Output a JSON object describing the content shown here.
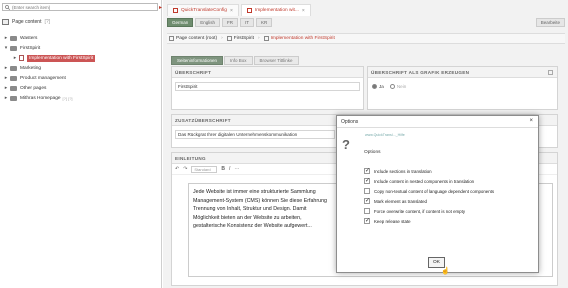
{
  "search": {
    "placeholder": "(Enter search item)"
  },
  "tree": {
    "root_label": "Page content",
    "root_extra": "[?]",
    "items": [
      {
        "label": "Wasters",
        "toggle": "▸",
        "type": "folder"
      },
      {
        "label": "FirstSpirit",
        "toggle": "▾",
        "type": "folder"
      },
      {
        "label": "Implementation with FirstSpirit",
        "toggle": "▸",
        "type": "page",
        "child": true,
        "selected": true
      },
      {
        "label": "Marketing",
        "toggle": "▸",
        "type": "folder"
      },
      {
        "label": "Product management",
        "toggle": "▸",
        "type": "folder"
      },
      {
        "label": "Other pages",
        "toggle": "▸",
        "type": "folder"
      },
      {
        "label": "Mithras Homepage",
        "toggle": "▸",
        "type": "folder",
        "extra": "[?] [?]"
      }
    ]
  },
  "tabs": [
    {
      "label": "QuickTranslateConfig",
      "close": "×"
    },
    {
      "label": "Implementation wit...",
      "close": "×"
    }
  ],
  "toolbar": {
    "languages": [
      "German",
      "English",
      "FR",
      "IT",
      "KR"
    ],
    "active_language": "German",
    "right_label": "Bearbeite"
  },
  "breadcrumb": {
    "items": [
      "Page content (root)",
      "FirstSpirit",
      "Implementation with FirstSpirit"
    ],
    "separator": "›"
  },
  "form_tabs": [
    "Seiteninformationen",
    "Info Box",
    "Browser Tittlinke"
  ],
  "fields": {
    "headline": {
      "label": "ÜBERSCHRIFT",
      "value": "FirstSpirit"
    },
    "headline_graphic": {
      "label": "ÜBERSCHRIFT ALS GRAFIK ERZEUGEN",
      "yes": "Ja",
      "no": "Nein"
    },
    "subheadline": {
      "label": "ZUSATZÜBERSCHRIFT",
      "value": "Das Rückgrat Ihrer digitalen Unternehmenskommunikation"
    },
    "intro": {
      "label": "EINLEITUNG",
      "toolbar": {
        "undo": "↶",
        "redo": "↷",
        "format": "Standard",
        "bold": "B",
        "italic": "I",
        "more": "···"
      },
      "lines": [
        "Jede Website ist immer eine strukturierte Sammlung",
        "Management-System (CMS) können Sie diese Erfahrung",
        "Trennung von Inhalt, Struktur und Design. Damit",
        "Möglichkeit bieten an der Website zu arbeiten,",
        "gestalterische Konsistenz der Website aufgewert..."
      ]
    }
  },
  "dialog": {
    "title": "Options",
    "close": "×",
    "help_icon": "?",
    "help_link": "www.QuickTransl..._Hilfe",
    "options_title": "Options",
    "options": [
      {
        "label": "Include sections in translation",
        "checked": true
      },
      {
        "label": "Include content in nested components in translation",
        "checked": true
      },
      {
        "label": "Copy non-textual content of language dependent components",
        "checked": false
      },
      {
        "label": "Mark element as translated",
        "checked": true
      },
      {
        "label": "Force overwrite content, if content is not empty",
        "checked": false
      },
      {
        "label": "Keep release state",
        "checked": true
      }
    ],
    "ok": "OK"
  },
  "colors": {
    "accent": "#c0392b",
    "active_lang": "#6f8d6f",
    "active_form_tab": "#7e947e"
  }
}
